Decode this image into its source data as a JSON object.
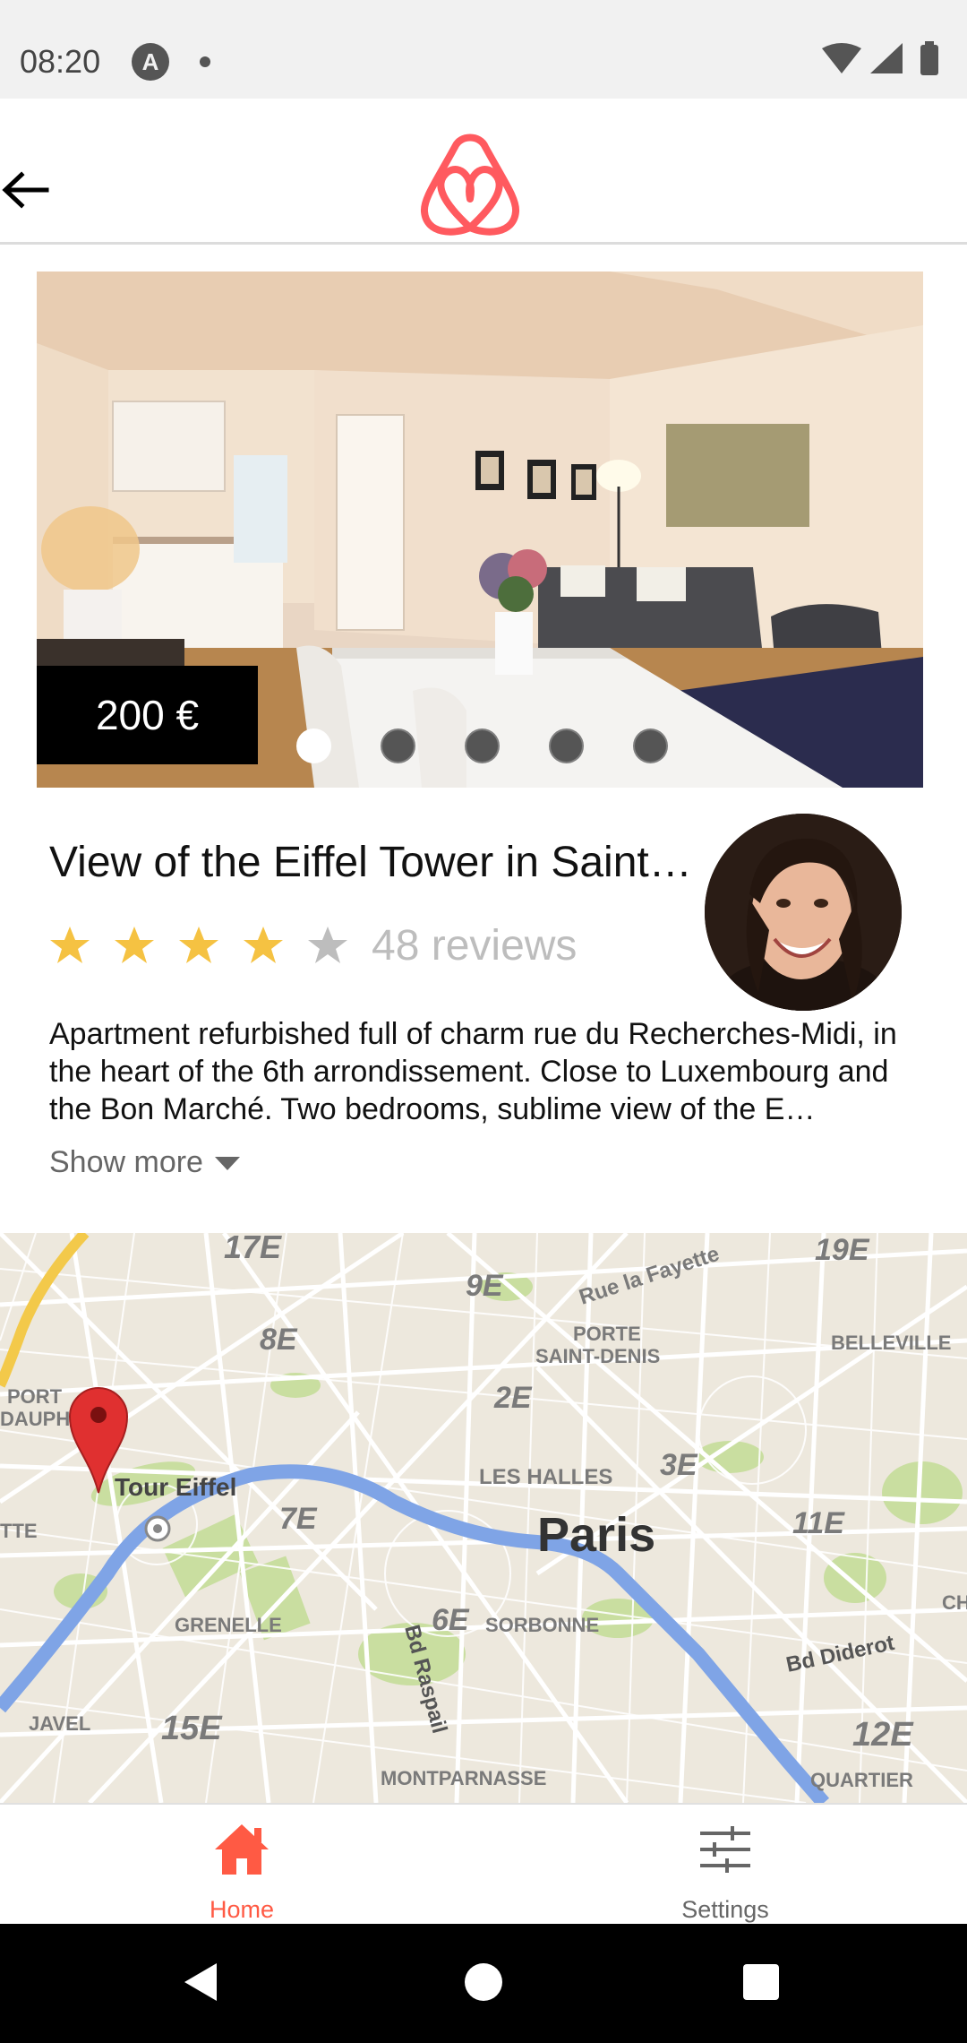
{
  "status_bar": {
    "time": "08:20",
    "notification_icon": "a-badge-icon",
    "icons": [
      "wifi-icon",
      "cellular-icon",
      "battery-icon"
    ]
  },
  "header": {
    "back_icon": "arrow-left-icon",
    "logo_icon": "airbnb-logo-icon"
  },
  "listing": {
    "price": "200 €",
    "photo_count": 5,
    "active_photo": 0,
    "title": "View of the Eiffel Tower in Saint…",
    "rating": 4,
    "rating_max": 5,
    "reviews": "48 reviews",
    "description": "Apartment refurbished full of charm rue du Recherches-Midi, in the heart of the 6th arrondissement. Close to Luxembourg and the Bon Marché. Two bedrooms, sublime view of the E…",
    "show_more": "Show more"
  },
  "map": {
    "labels": {
      "17e": "17E",
      "9e": "9E",
      "19e": "19E",
      "rue_la_fayette": "Rue la Fayette",
      "8e": "8E",
      "porte_saint_denis_1": "PORTE",
      "porte_saint_denis_2": "SAINT-DENIS",
      "belleville": "BELLEVILLE",
      "port_dauph_1": "PORT",
      "port_dauph_2": "DAUPH",
      "2e": "2E",
      "tour_eiffel": "Tour Eiffel",
      "les_halles": "LES HALLES",
      "3e": "3E",
      "tte": "TTE",
      "7e": "7E",
      "paris": "Paris",
      "11e": "11E",
      "grenelle": "GRENELLE",
      "6e": "6E",
      "sorbonne": "SORBONNE",
      "bd_raspail": "Bd Raspail",
      "bd_diderot": "Bd Diderot",
      "ch": "CH",
      "javel": "JAVEL",
      "15e": "15E",
      "12e": "12E",
      "montparnasse": "MONTPARNASSE",
      "quartier": "QUARTIER"
    },
    "pin_icon": "map-pin-icon",
    "colors": {
      "seine": "#7fa4e6",
      "park": "#c9dea0",
      "road": "#ffffff",
      "highway": "#f3c94a",
      "pin": "#e03030"
    }
  },
  "bottom_nav": {
    "items": [
      {
        "label": "Home",
        "icon": "home-icon",
        "active": true
      },
      {
        "label": "Settings",
        "icon": "sliders-icon",
        "active": false
      }
    ]
  },
  "colors": {
    "accent": "#ff5a44",
    "logo": "#ff5a5f",
    "star": "#f5c242",
    "star_empty": "#bdbdbd"
  }
}
